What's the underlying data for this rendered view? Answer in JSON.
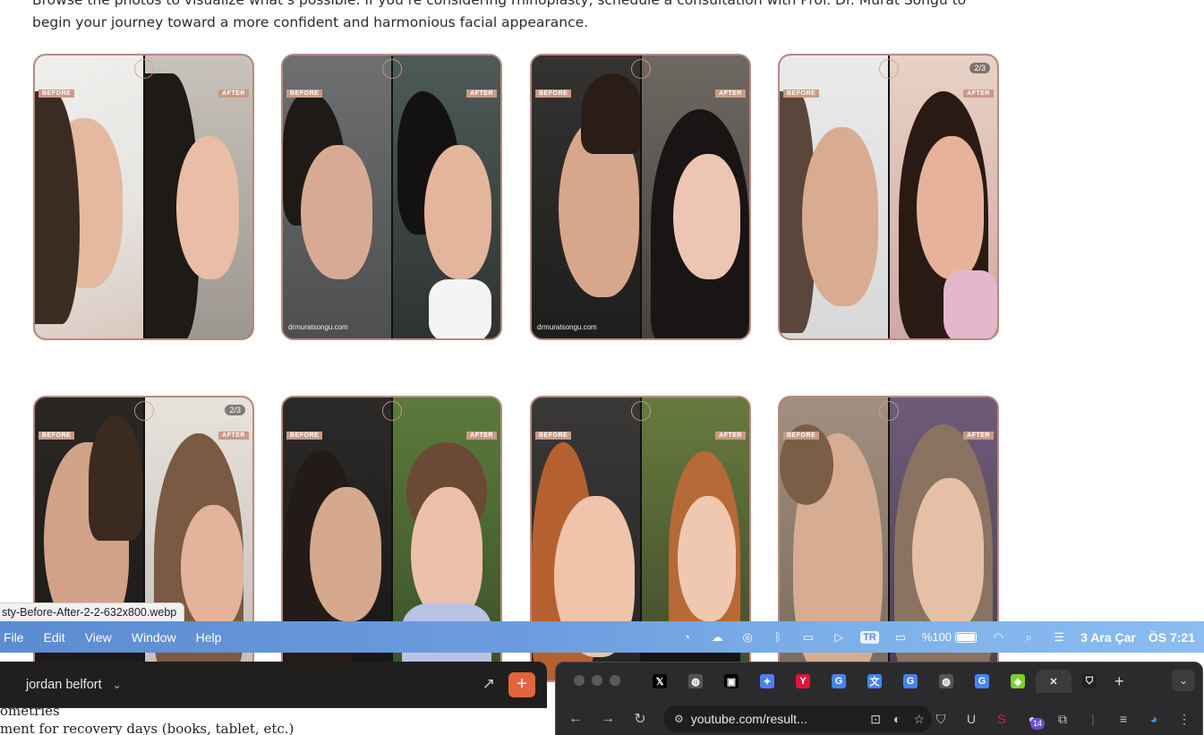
{
  "page": {
    "intro_line1": "Browse the photos to visualize what’s possible. If you’re considering rhinoplasty, schedule a consultation with Prof. Dr. Murat Songu to",
    "intro_line2": "begin your journey toward a more confident and harmonious facial appearance.",
    "before_label": "BEFORE",
    "after_label": "AFTER",
    "counter_label": "2/3",
    "watermark": "drmuratsongu.com",
    "link_preview": "sty-Before-After-2-2-632x800.webp"
  },
  "menubar": {
    "items": [
      "File",
      "Edit",
      "View",
      "Window",
      "Help"
    ],
    "lang": "TR",
    "battery": "%100",
    "date": "3 Ara Çar",
    "time": "ÖS 7:21"
  },
  "left_window": {
    "title": "jordan belfort",
    "doc_line1": "ometries",
    "doc_line2": "ment for recovery days (books, tablet, etc.)"
  },
  "browser": {
    "tabs": [
      {
        "icon": "x-icon",
        "glyph": "𝕏",
        "color": "#000000"
      },
      {
        "icon": "globe-icon",
        "glyph": "◍",
        "color": "#555555"
      },
      {
        "icon": "square-app-icon",
        "glyph": "▣",
        "color": "#000000"
      },
      {
        "icon": "gemini-icon",
        "glyph": "✦",
        "color": "#4c7ff2"
      },
      {
        "icon": "y-icon",
        "glyph": "Y",
        "color": "#e0143c"
      },
      {
        "icon": "google-icon",
        "glyph": "G",
        "color": "#4285f4"
      },
      {
        "icon": "translate-icon",
        "glyph": "文",
        "color": "#4285f4"
      },
      {
        "icon": "google-icon",
        "glyph": "G",
        "color": "#4285f4"
      },
      {
        "icon": "globe-icon",
        "glyph": "◍",
        "color": "#555555"
      },
      {
        "icon": "google-icon",
        "glyph": "G",
        "color": "#4285f4"
      },
      {
        "icon": "green-app-icon",
        "glyph": "◈",
        "color": "#7bd12a"
      },
      {
        "icon": "close-icon",
        "glyph": "✕",
        "color": "transparent"
      },
      {
        "icon": "shield-icon",
        "glyph": "⛉",
        "color": "#222222"
      }
    ],
    "url": "youtube.com/result...",
    "extension_badge": "14"
  }
}
